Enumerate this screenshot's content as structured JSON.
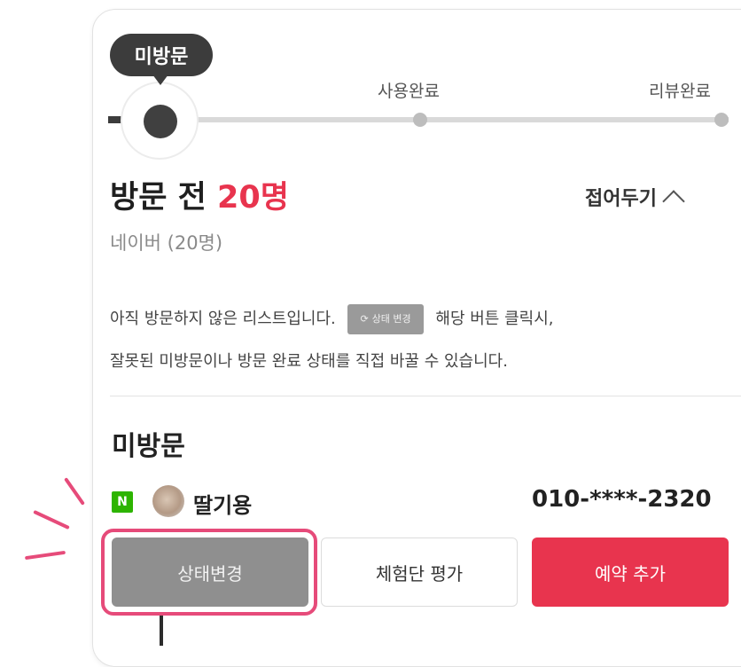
{
  "progress": {
    "current": "미방문",
    "steps": [
      "사용완료",
      "리뷰완료"
    ]
  },
  "header": {
    "title": "방문 전",
    "count": "20명",
    "sub": "네이버 (20명)",
    "collapse": "접어두기"
  },
  "notice": {
    "text1": "아직 방문하지 않은 리스트입니다.",
    "mini_button": "상태 변경",
    "text2": "해당 버튼 클릭시,",
    "text3": "잘못된 미방문이나 방문 완료 상태를 직접 바꿀 수 있습니다."
  },
  "section": {
    "title": "미방문"
  },
  "user": {
    "badge": "N",
    "nickname": "딸기용",
    "phone": "010-****-2320"
  },
  "actions": {
    "status": "상태변경",
    "evaluate": "체험단 평가",
    "reserve": "예약 추가"
  },
  "colors": {
    "accent": "#e8344e",
    "highlight": "#e64b7a",
    "naver": "#2db400"
  }
}
